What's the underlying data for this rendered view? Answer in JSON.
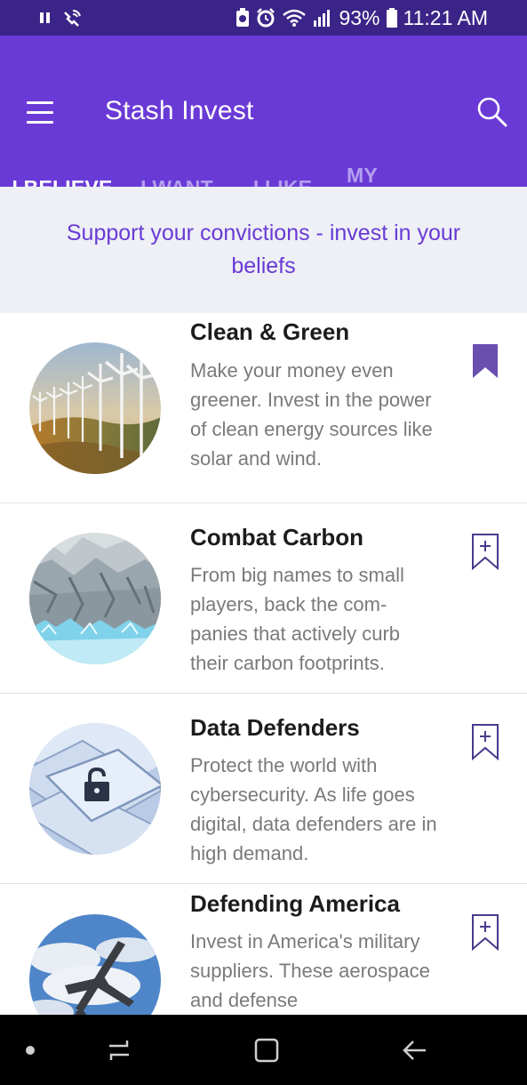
{
  "status_bar": {
    "battery": "93%",
    "time": "11:21 AM",
    "icons": [
      "pause-icon",
      "wifi-call-icon",
      "battery-saver-icon",
      "alarm-icon",
      "wifi-icon",
      "signal-icon",
      "battery-icon"
    ]
  },
  "app_bar": {
    "title": "Stash Invest",
    "menu_icon": "hamburger-menu-icon",
    "search_icon": "search-icon"
  },
  "tabs": [
    {
      "label": "I BELIEVE",
      "active": true
    },
    {
      "label": "I WANT",
      "active": false
    },
    {
      "label": "I LIKE",
      "active": false
    },
    {
      "label": "MY BOOKMARKS",
      "active": false
    }
  ],
  "banner": {
    "text": "Support your convictions - invest in your beliefs"
  },
  "items": [
    {
      "title": "Clean & Green",
      "description": "Make your money even greener. Invest in the power of clean energy sources like solar and wind.",
      "bookmarked": true,
      "image": "wind-turbines"
    },
    {
      "title": "Combat Carbon",
      "description": "From big names to small players, back the com-panies that actively curb their carbon footprints.",
      "bookmarked": false,
      "image": "glacier"
    },
    {
      "title": "Data Defenders",
      "description": "Protect the world with cybersecurity. As life goes digital, data defenders are in high demand.",
      "bookmarked": false,
      "image": "keyboard-lock"
    },
    {
      "title": "Defending America",
      "description": "Invest in America's military suppliers. These aerospace and defense",
      "bookmarked": false,
      "image": "fighter-jet"
    }
  ],
  "colors": {
    "status_bar": "#3b2487",
    "app_bar": "#6a3ad6",
    "tab_inactive": "#b39ff0",
    "banner_bg": "#eef0f5",
    "accent": "#6a3ad6",
    "bookmark_outline": "#4a3a8c"
  },
  "nav_bar": {
    "icons": [
      "dot-icon",
      "recent-apps-icon",
      "home-icon",
      "back-icon"
    ]
  }
}
